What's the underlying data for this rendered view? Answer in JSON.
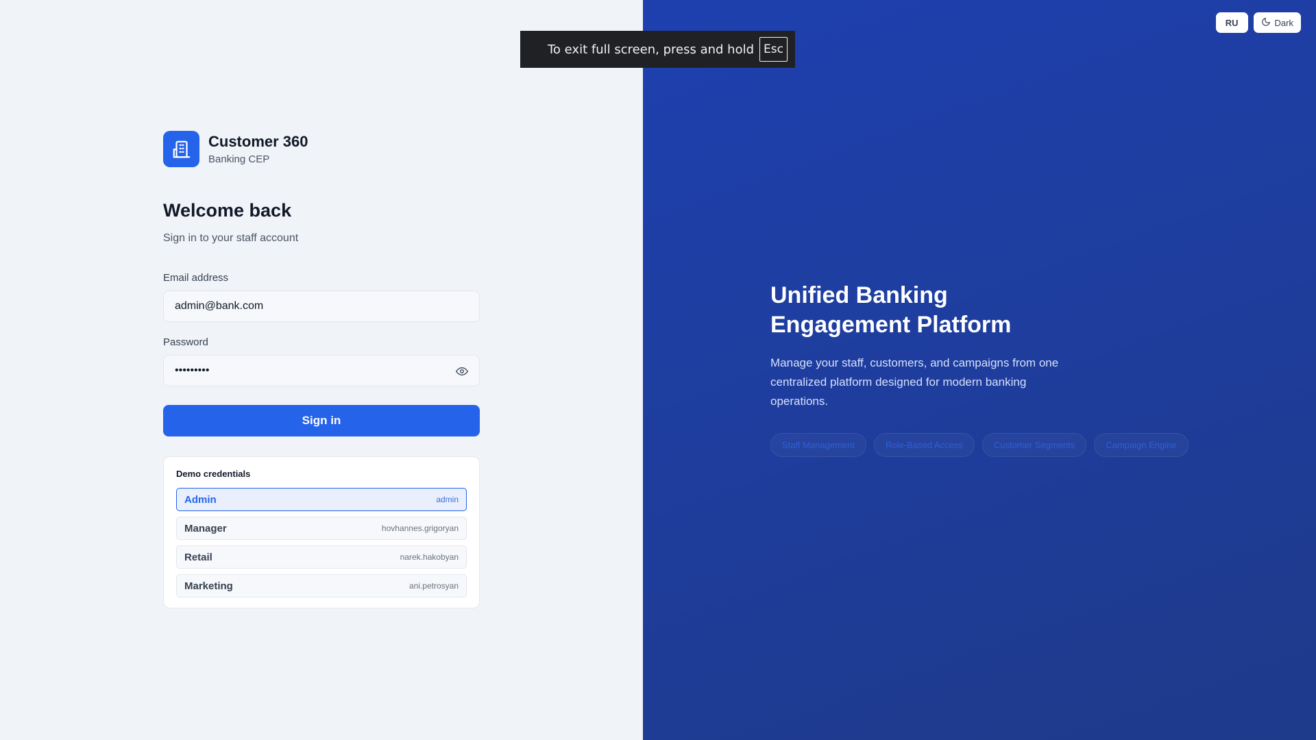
{
  "brand": {
    "title": "Customer 360",
    "subtitle": "Banking CEP",
    "logo_icon": "bank-building-icon",
    "color": "#2563eb"
  },
  "login": {
    "heading": "Welcome back",
    "subheading": "Sign in to your staff account",
    "email_label": "Email address",
    "email_value": "admin@bank.com",
    "password_label": "Password",
    "password_value": "•••••••••",
    "show_password_icon": "eye-icon",
    "submit_label": "Sign in"
  },
  "demo": {
    "title": "Demo credentials",
    "items": [
      {
        "role": "Admin",
        "user": "admin",
        "active": true
      },
      {
        "role": "Manager",
        "user": "hovhannes.grigoryan",
        "active": false
      },
      {
        "role": "Retail",
        "user": "narek.hakobyan",
        "active": false
      },
      {
        "role": "Marketing",
        "user": "ani.petrosyan",
        "active": false
      }
    ]
  },
  "hero": {
    "title_line1": "Unified Banking",
    "title_line2": "Engagement Platform",
    "description": "Manage your staff, customers, and campaigns from one centralized platform designed for modern banking operations.",
    "chips": [
      "Staff Management",
      "Role-Based Access",
      "Customer Segments",
      "Campaign Engine"
    ],
    "background": "#1e40af"
  },
  "top_controls": {
    "language_label": "RU",
    "theme_label": "Dark",
    "theme_icon": "moon-icon"
  },
  "fullscreen_toast": {
    "text": "To exit full screen, press and hold",
    "key": "Esc"
  }
}
